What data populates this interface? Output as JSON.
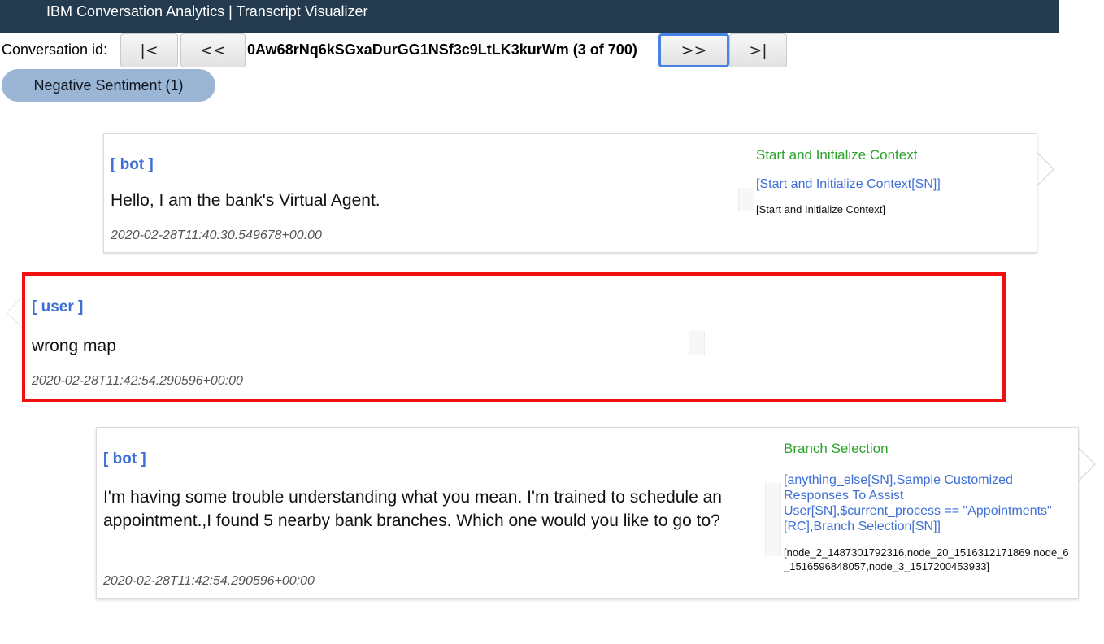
{
  "header": {
    "title": "IBM Conversation Analytics | Transcript Visualizer"
  },
  "navigation": {
    "label": "Conversation id:",
    "first_label": "|<",
    "prev_label": "<<",
    "conversation_id": "0Aw68rNq6kSGxaDurGG1NSf3c9LtLK3kurWm (3 of 700)",
    "next_label": ">>",
    "last_label": ">|"
  },
  "filter": {
    "sentiment_label": "Negative Sentiment (1)"
  },
  "messages": [
    {
      "speaker": "[ bot ]",
      "text": "Hello, I am the bank's Virtual Agent.",
      "timestamp": "2020-02-28T11:40:30.549678+00:00",
      "node_title": "Start and Initialize Context",
      "node_path": "[Start and Initialize Context[SN]]",
      "node_ids": "[Start and Initialize Context]"
    },
    {
      "speaker": "[ user ]",
      "text": "wrong map",
      "timestamp": "2020-02-28T11:42:54.290596+00:00"
    },
    {
      "speaker": "[ bot ]",
      "text": "I'm having some trouble understanding what you mean. I'm trained to schedule an appointment.,I found 5 nearby bank branches. Which one would you like to go to?",
      "timestamp": "2020-02-28T11:42:54.290596+00:00",
      "node_title": "Branch Selection",
      "node_path": "[anything_else[SN],Sample Customized Responses To Assist User[SN],$current_process == \"Appointments\"[RC],Branch Selection[SN]]",
      "node_ids": "[node_2_1487301792316,node_20_1516312171869,node_6_1516596848057,node_3_1517200453933]"
    }
  ],
  "colors": {
    "header_bg": "#243a4f",
    "speaker": "#3d6fd6",
    "node_title": "#2aa32a",
    "highlight_border": "#f01010",
    "sentiment_pill": "#9bb5d4"
  }
}
